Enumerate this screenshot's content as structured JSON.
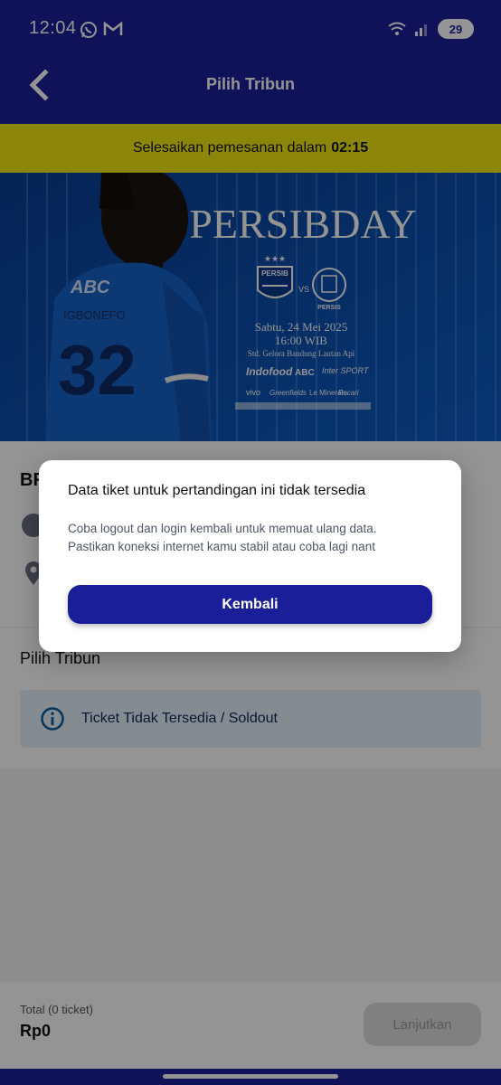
{
  "status_bar": {
    "time": "12:04",
    "battery": "29"
  },
  "header": {
    "title": "Pilih Tribun"
  },
  "timer": {
    "label": "Selesaikan pemesanan dalam",
    "value": "02:15"
  },
  "banner": {
    "event_title": "PERSIBDAY",
    "home_team": "PERSIB",
    "versus": "VS",
    "away_team": "PERSIS",
    "date": "Sabtu, 24 Mei 2025",
    "time": "16:00 WIB",
    "venue": "Std. Gelora Bandung Lautan Api",
    "jersey_sponsor": "ABC",
    "jersey_number": "32",
    "player_name": "IGBONEFO",
    "sponsors": [
      "Indofood",
      "ABC",
      "Inter SPORT",
      "vivo",
      "Greenfields",
      "Le Minerale",
      "Pocari"
    ]
  },
  "match": {
    "name_partial": "BR"
  },
  "tribun": {
    "section_title": "Pilih Tribun",
    "alert": "Ticket Tidak Tersedia / Soldout"
  },
  "footer": {
    "total_label": "Total (0 ticket)",
    "total_amount": "Rp0",
    "continue_label": "Lanjutkan"
  },
  "dialog": {
    "title": "Data tiket untuk pertandingan ini tidak tersedia",
    "line1": "Coba logout dan login kembali untuk memuat ulang data.",
    "line2": "Pastikan koneksi internet kamu stabil atau coba lagi nant",
    "button": "Kembali"
  },
  "colors": {
    "primary": "#1b1e99",
    "timer_bg": "#f1e914",
    "alert_bg": "#e3f1fb"
  }
}
